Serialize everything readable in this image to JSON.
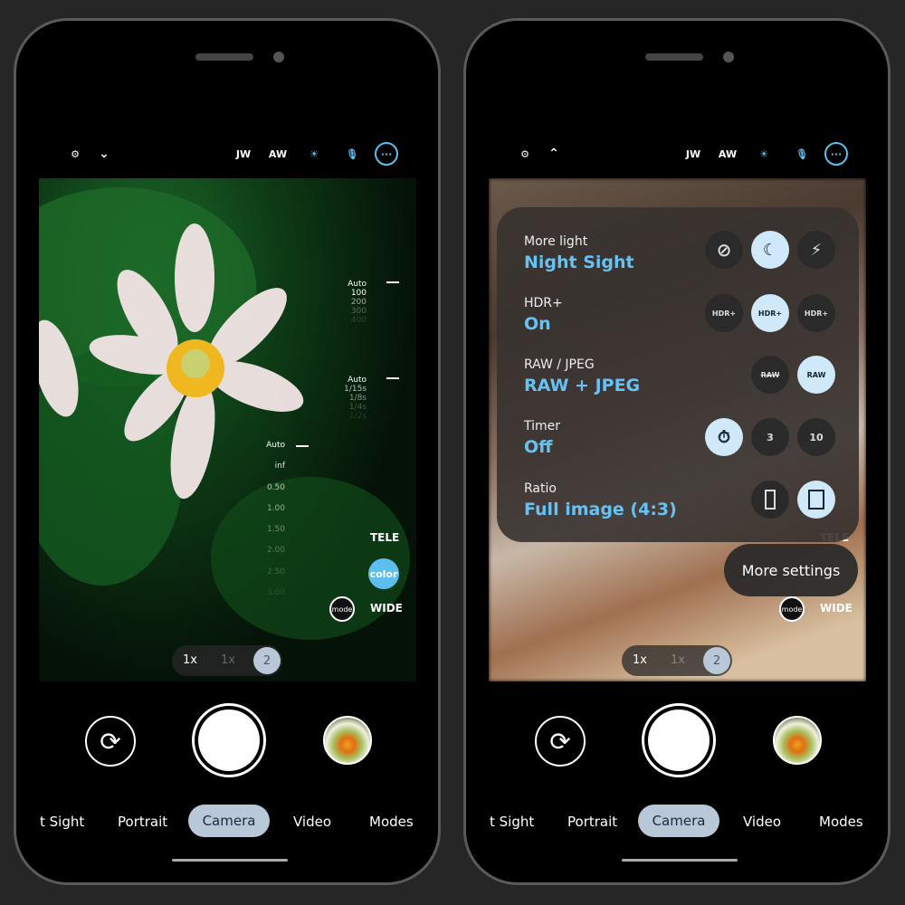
{
  "topbar": {
    "settings_icon": "camera-settings-icon",
    "chevron_left": "chevron-down-icon",
    "chevron_right": "chevron-up-icon",
    "jw": "JW",
    "aw": "AW",
    "sun_icon": "sunset-icon",
    "mic_icon": "mic-icon",
    "more_icon": "more-icon",
    "accent": "#5bc0f0"
  },
  "iso_scale": [
    "Auto",
    "100",
    "200",
    "300",
    "400"
  ],
  "shutter_scale": [
    "Auto",
    "1/15s",
    "1/8s",
    "1/4s",
    "1/2s"
  ],
  "focus_scale": [
    "Auto",
    "inf",
    "0.50",
    "1.00",
    "1.50",
    "2.00",
    "2.50",
    "3.00"
  ],
  "lens": {
    "tele": "TELE",
    "color": "color",
    "wide": "WIDE",
    "mode": "mode"
  },
  "zoom": {
    "a": "1x",
    "b": "1x",
    "c": "2"
  },
  "modes": [
    "t Sight",
    "Portrait",
    "Camera",
    "Video",
    "Modes"
  ],
  "panel": {
    "rows": [
      {
        "label": "More light",
        "value": "Night Sight",
        "options": [
          "Off",
          "Night Sight Auto",
          "Flash"
        ]
      },
      {
        "label": "HDR+",
        "value": "On",
        "options": [
          "HDR+ Off",
          "HDR+",
          "HDR+ Enhanced"
        ]
      },
      {
        "label": "RAW / JPEG",
        "value": "RAW + JPEG",
        "options": [
          "RAW off",
          "RAW"
        ]
      },
      {
        "label": "Timer",
        "value": "Off",
        "options": [
          "Off",
          "3",
          "10"
        ]
      },
      {
        "label": "Ratio",
        "value": "Full image (4:3)",
        "options": [
          "Full",
          "4:3"
        ]
      }
    ],
    "more_settings": "More settings"
  }
}
